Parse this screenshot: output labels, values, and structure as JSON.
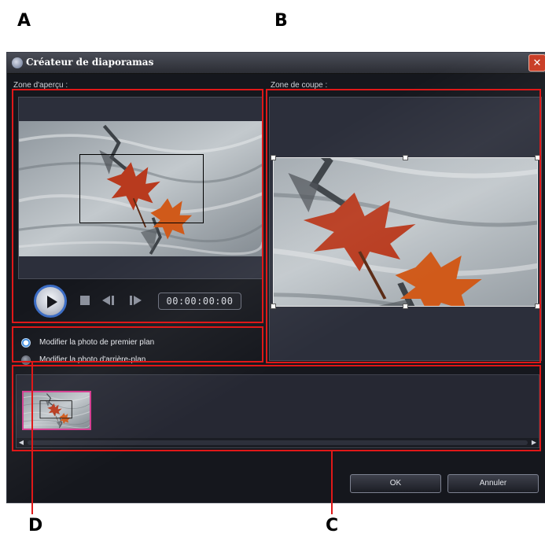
{
  "callouts": {
    "a": "A",
    "b": "B",
    "c": "C",
    "d": "D"
  },
  "window": {
    "title": "Créateur de diaporamas",
    "close_glyph": "✕"
  },
  "preview": {
    "label": "Zone d'aperçu :",
    "timecode": "00:00:00:00"
  },
  "crop": {
    "label": "Zone de coupe :"
  },
  "options": [
    {
      "label": "Modifier la photo de premier plan",
      "selected": true
    },
    {
      "label": "Modifier la photo d'arrière-plan",
      "selected": false
    }
  ],
  "buttons": {
    "ok": "OK",
    "cancel": "Annuler"
  },
  "colors": {
    "highlight": "#e01818",
    "window_bg": "#15171d",
    "thumb_border": "#d43a8e",
    "play_ring": "#3b6cc4"
  },
  "icons": [
    "play-icon",
    "stop-icon",
    "previous-frame-icon",
    "next-frame-icon",
    "scroll-left-icon",
    "scroll-right-icon"
  ]
}
